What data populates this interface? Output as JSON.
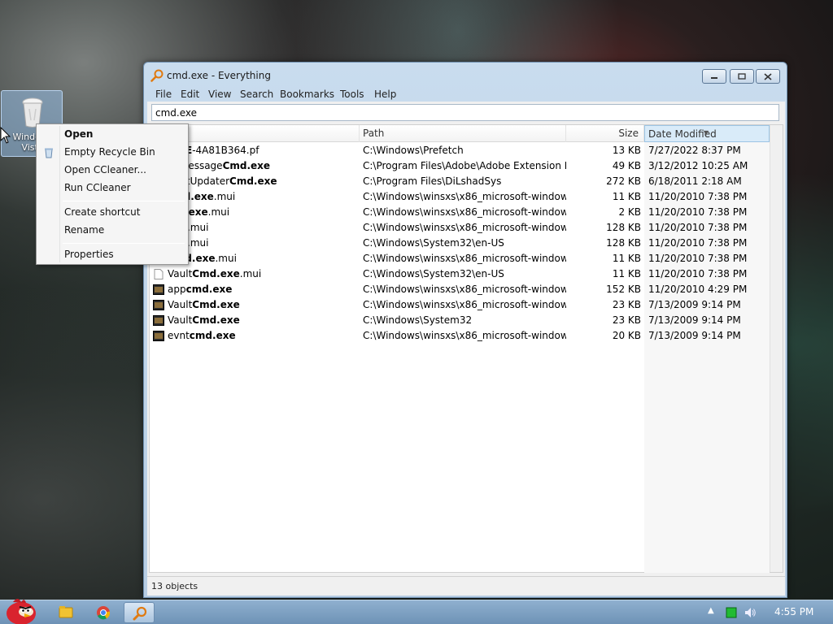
{
  "desktop": {
    "icon_label": "Windows Vista"
  },
  "window": {
    "title": "cmd.exe - Everything",
    "menu": [
      "File",
      "Edit",
      "View",
      "Search",
      "Bookmarks",
      "Tools",
      "Help"
    ],
    "search_value": "cmd.exe",
    "columns": {
      "name": "Name",
      "path": "Path",
      "size": "Size",
      "date": "Date Modified"
    },
    "rows": [
      {
        "name_pre": "",
        "name_bold": ".EXE",
        "name_post": "-4A81B364.pf",
        "path": "C:\\Windows\\Prefetch",
        "size": "13 KB",
        "date": "7/27/2022 8:37 PM",
        "icon": "file"
      },
      {
        "name_pre": "anMessage",
        "name_bold": "Cmd.exe",
        "name_post": "",
        "path": "C:\\Program Files\\Adobe\\Adobe Extension M...",
        "size": "49 KB",
        "date": "3/12/2012 10:25 AM",
        "icon": "file"
      },
      {
        "name_pre": "BootUpdater",
        "name_bold": "Cmd.exe",
        "name_post": "",
        "path": "C:\\Program Files\\DiLshadSys",
        "size": "272 KB",
        "date": "6/18/2011 2:18 AM",
        "icon": "file"
      },
      {
        "name_pre": "",
        "name_bold": "cmd.exe",
        "name_post": ".mui",
        "path": "C:\\Windows\\winsxs\\x86_microsoft-windows-...",
        "size": "11 KB",
        "date": "11/20/2010 7:38 PM",
        "icon": "file"
      },
      {
        "name_pre": "",
        "name_bold": "md.exe",
        "name_post": ".mui",
        "path": "C:\\Windows\\winsxs\\x86_microsoft-windows-...",
        "size": "2 KB",
        "date": "11/20/2010 7:38 PM",
        "icon": "file"
      },
      {
        "name_pre": "",
        "name_bold": "exe",
        "name_post": ".mui",
        "path": "C:\\Windows\\winsxs\\x86_microsoft-windows-...",
        "size": "128 KB",
        "date": "11/20/2010 7:38 PM",
        "icon": "file"
      },
      {
        "name_pre": "",
        "name_bold": "exe",
        "name_post": ".mui",
        "path": "C:\\Windows\\System32\\en-US",
        "size": "128 KB",
        "date": "11/20/2010 7:38 PM",
        "icon": "file"
      },
      {
        "name_pre": "",
        "name_bold": "Cmd.exe",
        "name_post": ".mui",
        "path": "C:\\Windows\\winsxs\\x86_microsoft-windows-...",
        "size": "11 KB",
        "date": "11/20/2010 7:38 PM",
        "icon": "file"
      },
      {
        "name_pre": "Vault",
        "name_bold": "Cmd.exe",
        "name_post": ".mui",
        "path": "C:\\Windows\\System32\\en-US",
        "size": "11 KB",
        "date": "11/20/2010 7:38 PM",
        "icon": "file"
      },
      {
        "name_pre": "app",
        "name_bold": "cmd.exe",
        "name_post": "",
        "path": "C:\\Windows\\winsxs\\x86_microsoft-windows-...",
        "size": "152 KB",
        "date": "11/20/2010 4:29 PM",
        "icon": "exe"
      },
      {
        "name_pre": "Vault",
        "name_bold": "Cmd.exe",
        "name_post": "",
        "path": "C:\\Windows\\winsxs\\x86_microsoft-windows-...",
        "size": "23 KB",
        "date": "7/13/2009 9:14 PM",
        "icon": "exe"
      },
      {
        "name_pre": "Vault",
        "name_bold": "Cmd.exe",
        "name_post": "",
        "path": "C:\\Windows\\System32",
        "size": "23 KB",
        "date": "7/13/2009 9:14 PM",
        "icon": "exe"
      },
      {
        "name_pre": "evnt",
        "name_bold": "cmd.exe",
        "name_post": "",
        "path": "C:\\Windows\\winsxs\\x86_microsoft-windows-...",
        "size": "20 KB",
        "date": "7/13/2009 9:14 PM",
        "icon": "exe"
      }
    ],
    "status": "13 objects"
  },
  "context_menu": {
    "items": [
      "Open",
      "Empty Recycle Bin",
      "Open CCleaner...",
      "Run CCleaner",
      "Create shortcut",
      "Rename",
      "Properties"
    ]
  },
  "taskbar": {
    "clock": "4:55 PM"
  },
  "colors": {
    "selection_header": "#d9ebf9",
    "taskbar": "#7ea2c6"
  }
}
